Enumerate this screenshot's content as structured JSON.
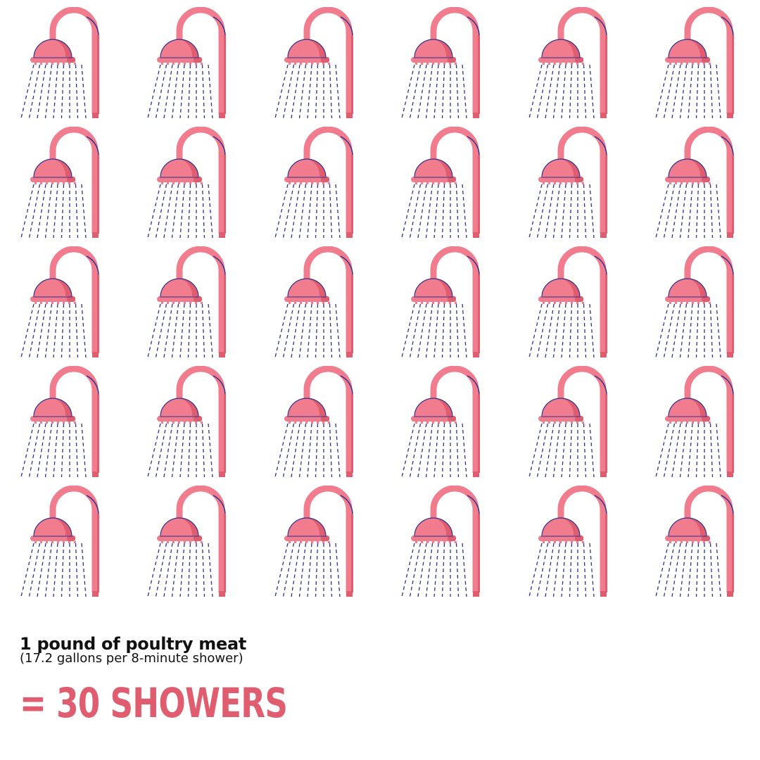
{
  "icon": {
    "name": "shower-icon",
    "count": 30
  },
  "colors": {
    "pink": "#f17c8e",
    "pink_dark": "#e05c6f",
    "water": "#2e3191",
    "result_text": "#e05c6f"
  },
  "caption": {
    "title": "1 pound of poultry meat",
    "subtitle": "(17.2 gallons per 8-minute shower)"
  },
  "result": "= 30 SHOWERS"
}
